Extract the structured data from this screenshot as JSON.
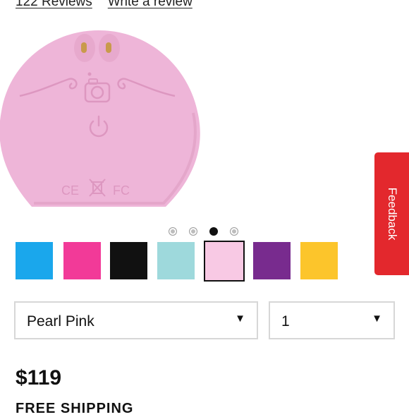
{
  "reviews": {
    "count_label": "122 Reviews",
    "write_label": "Write a review"
  },
  "product": {
    "icon": "pearl-pink-face-brush-device",
    "color_hex": "#eeb5d8",
    "marks": {
      "ce": "CE",
      "fc": "FC"
    }
  },
  "carousel": {
    "count": 4,
    "active_index": 2
  },
  "swatches": [
    {
      "name": "blue",
      "color": "#1aa7ec"
    },
    {
      "name": "pink",
      "color": "#f23a98"
    },
    {
      "name": "black",
      "color": "#111111"
    },
    {
      "name": "aqua",
      "color": "#9ed9dc"
    },
    {
      "name": "pearl-pink",
      "color": "#f8c9e4",
      "selected": true
    },
    {
      "name": "purple",
      "color": "#782b8e"
    },
    {
      "name": "yellow",
      "color": "#fcc52b"
    }
  ],
  "variant_select": {
    "value": "Pearl Pink",
    "arrow": "▼"
  },
  "quantity_select": {
    "value": "1",
    "arrow": "▼"
  },
  "price": "$119",
  "shipping": "FREE SHIPPING",
  "feedback": {
    "label": "Feedback",
    "color": "#e3282d"
  }
}
